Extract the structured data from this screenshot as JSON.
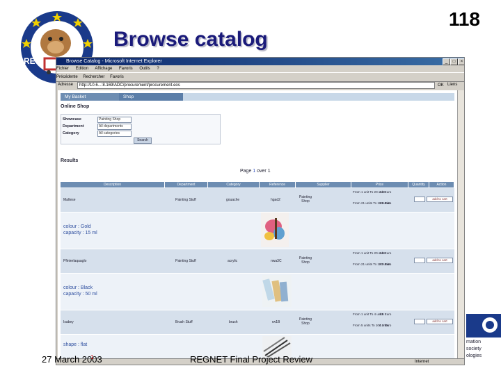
{
  "slide": {
    "title": "Browse catalog",
    "number": "118",
    "footer_date": "27 March 2003",
    "footer_title": "REGNET Final Project Review",
    "footer_overlap_num": "1",
    "logo_letters": "REG",
    "corner_logo_text": [
      "mation",
      "society",
      "ologies"
    ]
  },
  "browser": {
    "title": "Browse Catalog - Microsoft Internet Explorer",
    "menu": [
      "Fichier",
      "Edition",
      "Affichage",
      "Favoris",
      "Outils",
      "?"
    ],
    "toolbar": [
      "Précédente",
      "Rechercher",
      "Favoris"
    ],
    "address_label": "Adresse",
    "address_value": "http://10.6...:8.169/ADC/procurement/procurement.eos",
    "go_label": "OK",
    "links_label": "Liens",
    "status_text": "Internet"
  },
  "page": {
    "tabs": [
      "My Basket",
      "Shop"
    ],
    "heading": "Online Shop",
    "filters": [
      {
        "label": "Showcase",
        "value": "Painting Shop"
      },
      {
        "label": "Department",
        "value": "All departments"
      },
      {
        "label": "Category",
        "value": "All categories"
      }
    ],
    "search_label": "Search",
    "results_title": "Results",
    "pager_prefix": "Page ",
    "pager_current": "1",
    "pager_suffix": " over 1",
    "columns": [
      "Description",
      "Department",
      "Category",
      "Reference",
      "Supplier",
      "Price",
      "Quantity",
      "Action"
    ],
    "add_label": "add to cart",
    "products": [
      {
        "description": "Maltese",
        "department": "Painting Stuff",
        "category": "gouache",
        "reference": "hgad2",
        "supplier": "Painting Shop",
        "prices": [
          "From 1 unit To 20 units",
          "From 21 units To 100 units"
        ],
        "price_values": [
          "2.0 Euro",
          "1.8 Euro"
        ],
        "detail": [
          "colour : Gold",
          "capacity : 15 ml"
        ]
      },
      {
        "description": "Pfinterlaquaglo",
        "department": "Painting Stuff",
        "category": "acrylic",
        "reference": "nwa3C",
        "supplier": "Painting Shop",
        "prices": [
          "From 1 unit To 20 units",
          "From 21 units To 100 units"
        ],
        "price_values": [
          "2.5 Euro",
          "2.2 Euro"
        ],
        "detail": [
          "colour : Black",
          "capacity : 50 ml"
        ]
      },
      {
        "description": "Isabey",
        "department": "Brush Stuff",
        "category": "brush",
        "reference": "rw1B",
        "supplier": "Painting Shop",
        "prices": [
          "From 1 unit To 4 units",
          "From 5 units To 100 units"
        ],
        "price_values": [
          "4.5 Euro",
          "4.0 Euro"
        ],
        "detail": [
          "shape : flat"
        ]
      }
    ]
  },
  "colors": {
    "title": "#1a1a7a",
    "tab_bar": "#6d8db2",
    "row_bg": "#d6e0ec"
  }
}
